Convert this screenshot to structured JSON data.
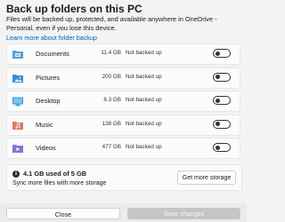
{
  "header": {
    "title": "Back up folders on this PC",
    "description": "Files will be backed up, protected, and available anywhere in OneDrive - Personal, even if you lose this device.",
    "learn_link": "Learn more about folder backup"
  },
  "folders": [
    {
      "name": "Documents",
      "size": "11.4 GB",
      "status": "Not backed up",
      "icon": "documents-folder-icon",
      "backup_on": false
    },
    {
      "name": "Pictures",
      "size": "200 GB",
      "status": "Not backed up",
      "icon": "pictures-folder-icon",
      "backup_on": false
    },
    {
      "name": "Desktop",
      "size": "6.3 GB",
      "status": "Not backed up",
      "icon": "desktop-folder-icon",
      "backup_on": false
    },
    {
      "name": "Music",
      "size": "138 GB",
      "status": "Not backed up",
      "icon": "music-folder-icon",
      "backup_on": false
    },
    {
      "name": "Videos",
      "size": "477 GB",
      "status": "Not backed up",
      "icon": "videos-folder-icon",
      "backup_on": false
    }
  ],
  "storage": {
    "used_text": "4.1 GB used of 5 GB",
    "sync_text": "Sync more files with more storage",
    "more_button": "Get more storage",
    "info_icon": "info-icon"
  },
  "footer": {
    "close_label": "Close",
    "save_label": "Save changes"
  },
  "colors": {
    "link": "#0063b1",
    "documents": "#5aa0d8",
    "pictures": "#3a8fd6",
    "desktop": "#2e9bd6",
    "music": "#e07a5f",
    "videos": "#8e6fd8"
  }
}
